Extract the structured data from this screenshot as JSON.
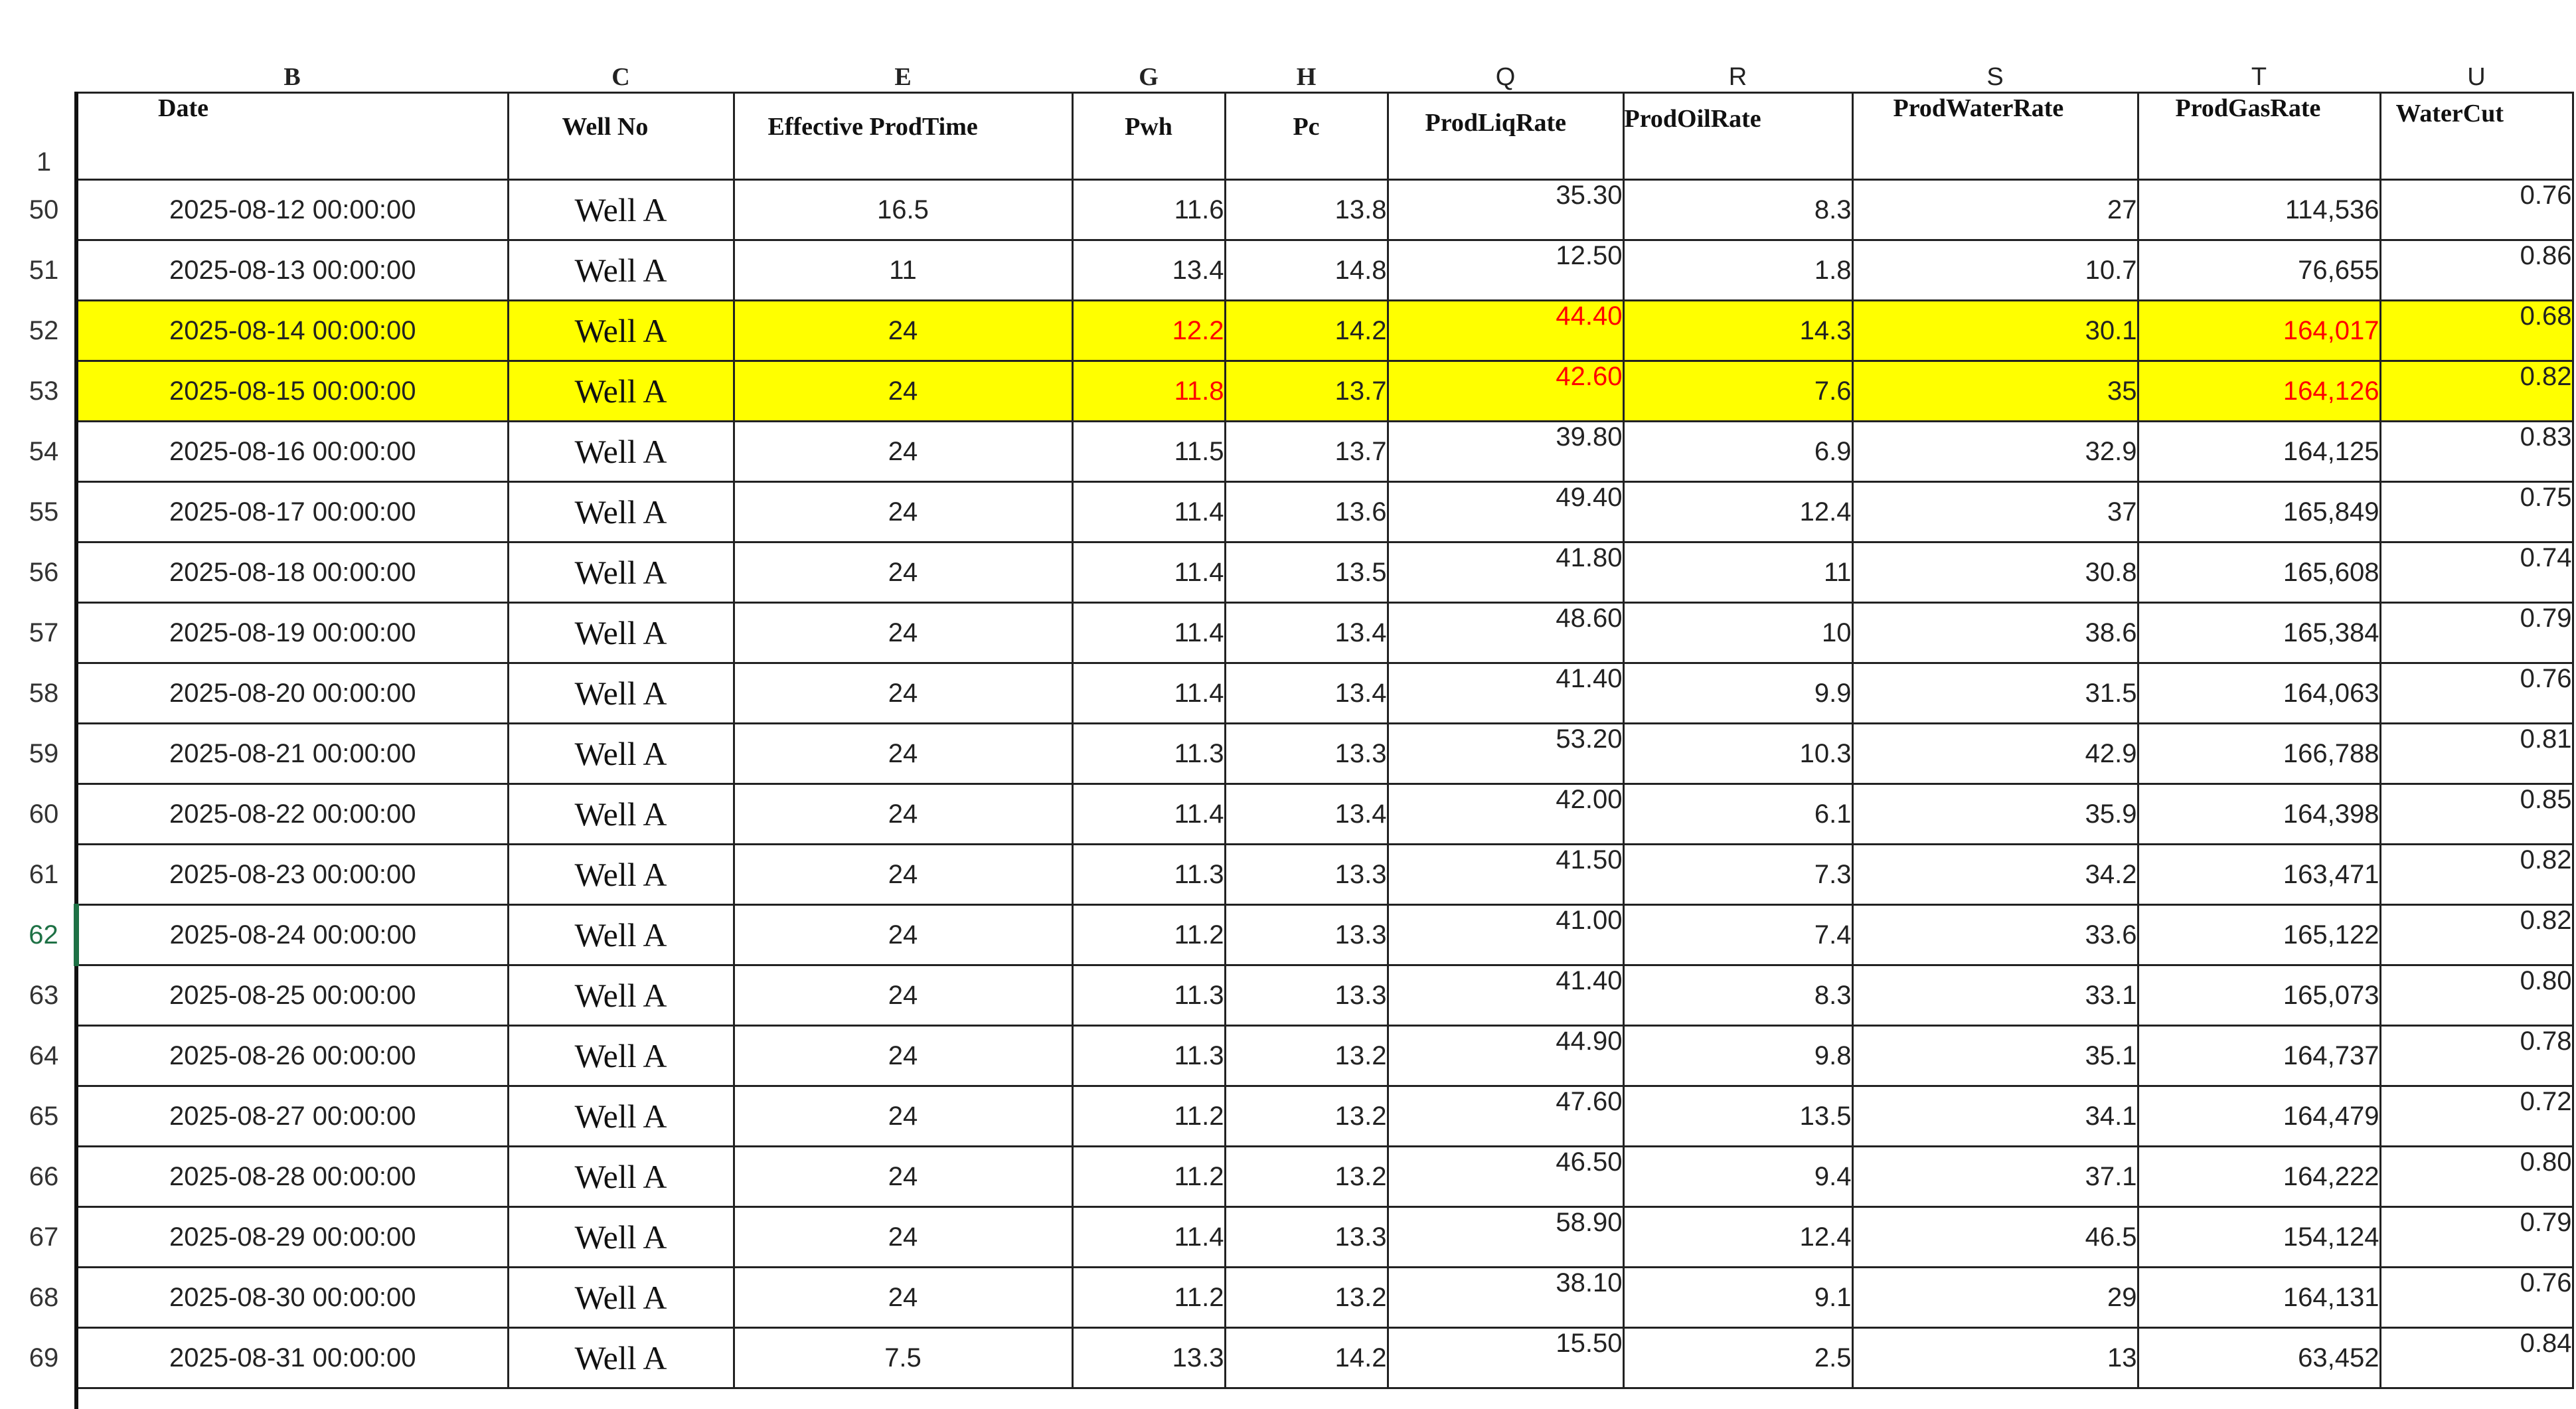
{
  "columns": [
    "B",
    "C",
    "E",
    "G",
    "H",
    "Q",
    "R",
    "S",
    "T",
    "U"
  ],
  "header_row_number": "1",
  "headers": [
    "Date",
    "Well No",
    "Effective ProdTime",
    "Pwh",
    "Pc",
    "ProdLiqRate",
    "ProdOilRate",
    "ProdWaterRate",
    "ProdGasRate",
    "WaterCut"
  ],
  "active_row": "62",
  "highlight_color": "#ffff00",
  "alert_text_color": "#ff0000",
  "rows": [
    {
      "n": "50",
      "date": "2025-08-12 00:00:00",
      "well": "Well A",
      "time": "16.5",
      "pwh": "11.6",
      "pc": "13.8",
      "liq": "35.30",
      "oil": "8.3",
      "water": "27",
      "gas": "114,536",
      "wc": "0.76"
    },
    {
      "n": "51",
      "date": "2025-08-13 00:00:00",
      "well": "Well A",
      "time": "11",
      "pwh": "13.4",
      "pc": "14.8",
      "liq": "12.50",
      "oil": "1.8",
      "water": "10.7",
      "gas": "76,655",
      "wc": "0.86"
    },
    {
      "n": "52",
      "date": "2025-08-14 00:00:00",
      "well": "Well A",
      "time": "24",
      "pwh": "12.2",
      "pc": "14.2",
      "liq": "44.40",
      "oil": "14.3",
      "water": "30.1",
      "gas": "164,017",
      "wc": "0.68"
    },
    {
      "n": "53",
      "date": "2025-08-15 00:00:00",
      "well": "Well A",
      "time": "24",
      "pwh": "11.8",
      "pc": "13.7",
      "liq": "42.60",
      "oil": "7.6",
      "water": "35",
      "gas": "164,126",
      "wc": "0.82"
    },
    {
      "n": "54",
      "date": "2025-08-16 00:00:00",
      "well": "Well A",
      "time": "24",
      "pwh": "11.5",
      "pc": "13.7",
      "liq": "39.80",
      "oil": "6.9",
      "water": "32.9",
      "gas": "164,125",
      "wc": "0.83"
    },
    {
      "n": "55",
      "date": "2025-08-17 00:00:00",
      "well": "Well A",
      "time": "24",
      "pwh": "11.4",
      "pc": "13.6",
      "liq": "49.40",
      "oil": "12.4",
      "water": "37",
      "gas": "165,849",
      "wc": "0.75"
    },
    {
      "n": "56",
      "date": "2025-08-18 00:00:00",
      "well": "Well A",
      "time": "24",
      "pwh": "11.4",
      "pc": "13.5",
      "liq": "41.80",
      "oil": "11",
      "water": "30.8",
      "gas": "165,608",
      "wc": "0.74"
    },
    {
      "n": "57",
      "date": "2025-08-19 00:00:00",
      "well": "Well A",
      "time": "24",
      "pwh": "11.4",
      "pc": "13.4",
      "liq": "48.60",
      "oil": "10",
      "water": "38.6",
      "gas": "165,384",
      "wc": "0.79"
    },
    {
      "n": "58",
      "date": "2025-08-20 00:00:00",
      "well": "Well A",
      "time": "24",
      "pwh": "11.4",
      "pc": "13.4",
      "liq": "41.40",
      "oil": "9.9",
      "water": "31.5",
      "gas": "164,063",
      "wc": "0.76"
    },
    {
      "n": "59",
      "date": "2025-08-21 00:00:00",
      "well": "Well A",
      "time": "24",
      "pwh": "11.3",
      "pc": "13.3",
      "liq": "53.20",
      "oil": "10.3",
      "water": "42.9",
      "gas": "166,788",
      "wc": "0.81"
    },
    {
      "n": "60",
      "date": "2025-08-22 00:00:00",
      "well": "Well A",
      "time": "24",
      "pwh": "11.4",
      "pc": "13.4",
      "liq": "42.00",
      "oil": "6.1",
      "water": "35.9",
      "gas": "164,398",
      "wc": "0.85"
    },
    {
      "n": "61",
      "date": "2025-08-23 00:00:00",
      "well": "Well A",
      "time": "24",
      "pwh": "11.3",
      "pc": "13.3",
      "liq": "41.50",
      "oil": "7.3",
      "water": "34.2",
      "gas": "163,471",
      "wc": "0.82"
    },
    {
      "n": "62",
      "date": "2025-08-24 00:00:00",
      "well": "Well A",
      "time": "24",
      "pwh": "11.2",
      "pc": "13.3",
      "liq": "41.00",
      "oil": "7.4",
      "water": "33.6",
      "gas": "165,122",
      "wc": "0.82"
    },
    {
      "n": "63",
      "date": "2025-08-25 00:00:00",
      "well": "Well A",
      "time": "24",
      "pwh": "11.3",
      "pc": "13.3",
      "liq": "41.40",
      "oil": "8.3",
      "water": "33.1",
      "gas": "165,073",
      "wc": "0.80"
    },
    {
      "n": "64",
      "date": "2025-08-26 00:00:00",
      "well": "Well A",
      "time": "24",
      "pwh": "11.3",
      "pc": "13.2",
      "liq": "44.90",
      "oil": "9.8",
      "water": "35.1",
      "gas": "164,737",
      "wc": "0.78"
    },
    {
      "n": "65",
      "date": "2025-08-27 00:00:00",
      "well": "Well A",
      "time": "24",
      "pwh": "11.2",
      "pc": "13.2",
      "liq": "47.60",
      "oil": "13.5",
      "water": "34.1",
      "gas": "164,479",
      "wc": "0.72"
    },
    {
      "n": "66",
      "date": "2025-08-28 00:00:00",
      "well": "Well A",
      "time": "24",
      "pwh": "11.2",
      "pc": "13.2",
      "liq": "46.50",
      "oil": "9.4",
      "water": "37.1",
      "gas": "164,222",
      "wc": "0.80"
    },
    {
      "n": "67",
      "date": "2025-08-29 00:00:00",
      "well": "Well A",
      "time": "24",
      "pwh": "11.4",
      "pc": "13.3",
      "liq": "58.90",
      "oil": "12.4",
      "water": "46.5",
      "gas": "154,124",
      "wc": "0.79"
    },
    {
      "n": "68",
      "date": "2025-08-30 00:00:00",
      "well": "Well A",
      "time": "24",
      "pwh": "11.2",
      "pc": "13.2",
      "liq": "38.10",
      "oil": "9.1",
      "water": "29",
      "gas": "164,131",
      "wc": "0.76"
    },
    {
      "n": "69",
      "date": "2025-08-31 00:00:00",
      "well": "Well A",
      "time": "7.5",
      "pwh": "13.3",
      "pc": "14.2",
      "liq": "15.50",
      "oil": "2.5",
      "water": "13",
      "gas": "63,452",
      "wc": "0.84"
    }
  ]
}
